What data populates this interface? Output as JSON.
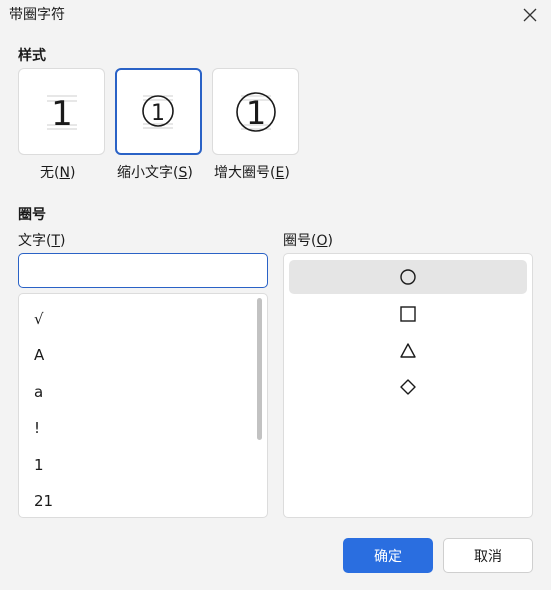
{
  "dialog": {
    "title": "带圈字符"
  },
  "style": {
    "section_label": "样式",
    "options": [
      {
        "glyph": "1",
        "label": "无(",
        "hotkey": "N",
        "label_end": ")",
        "selected": false
      },
      {
        "glyph": "①",
        "label": "缩小文字(",
        "hotkey": "S",
        "label_end": ")",
        "selected": true
      },
      {
        "glyph": "①",
        "label": "增大圈号(",
        "hotkey": "E",
        "label_end": ")",
        "selected": false
      }
    ]
  },
  "enclosure": {
    "section_label": "圈号",
    "text_label": "文字(",
    "text_hotkey": "T",
    "text_label_end": ")",
    "text_value": "",
    "text_items": [
      "√",
      "A",
      "a",
      "!",
      "1",
      "21"
    ],
    "shape_label": "圈号(",
    "shape_hotkey": "O",
    "shape_label_end": ")",
    "shapes": [
      {
        "icon": "circle-icon",
        "selected": true
      },
      {
        "icon": "square-icon",
        "selected": false
      },
      {
        "icon": "triangle-icon",
        "selected": false
      },
      {
        "icon": "diamond-icon",
        "selected": false
      }
    ]
  },
  "buttons": {
    "ok": "确定",
    "cancel": "取消"
  },
  "colors": {
    "accent": "#2a6ee0",
    "selected_border": "#2a62c6",
    "background": "#f3f3f3"
  }
}
